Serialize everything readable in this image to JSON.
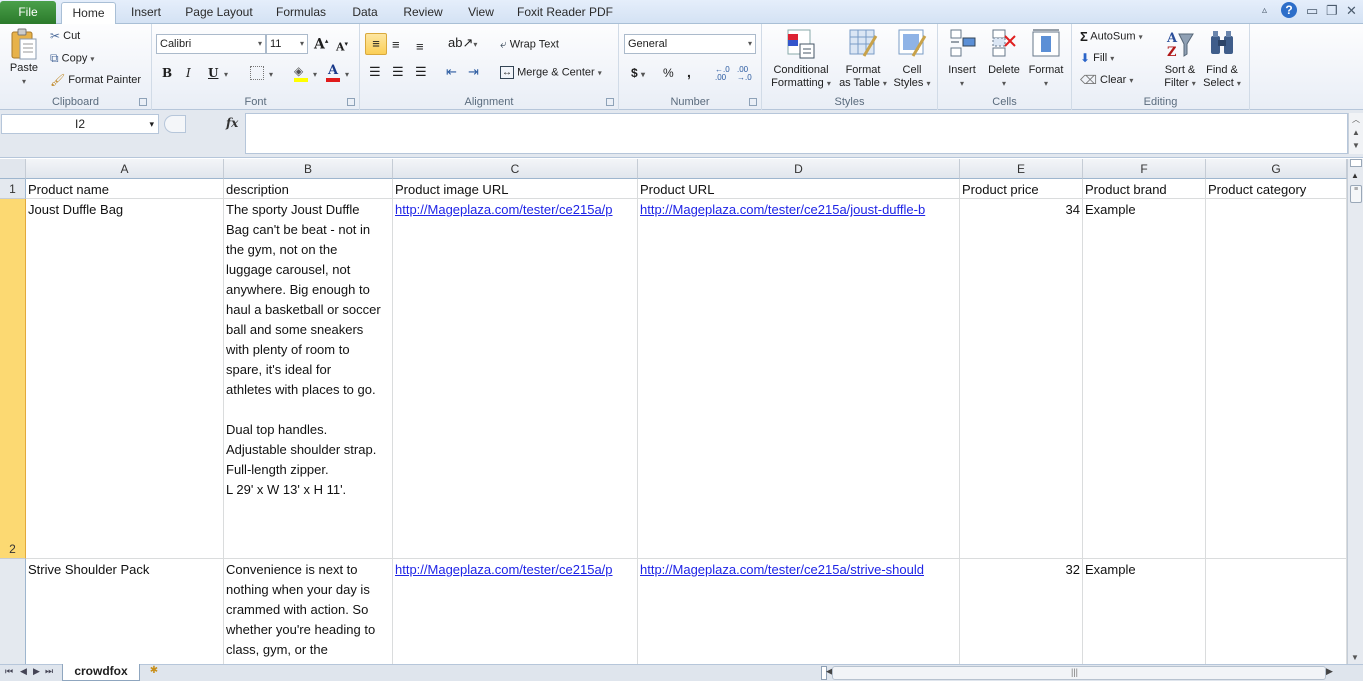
{
  "ribbon_tabs": [
    {
      "label": "File"
    },
    {
      "label": "Home",
      "active": true
    },
    {
      "label": "Insert"
    },
    {
      "label": "Page Layout"
    },
    {
      "label": "Formulas"
    },
    {
      "label": "Data"
    },
    {
      "label": "Review"
    },
    {
      "label": "View"
    },
    {
      "label": "Foxit Reader PDF"
    }
  ],
  "window_controls": {
    "minimize_ribbon": "▵",
    "help": "?",
    "minimize": "▭",
    "restore": "❐",
    "close": "✕"
  },
  "clipboard": {
    "group_label": "Clipboard",
    "paste": "Paste",
    "cut": "Cut",
    "copy": "Copy",
    "format_painter": "Format Painter"
  },
  "font": {
    "group_label": "Font",
    "font_name": "Calibri",
    "font_size": "11",
    "bold": "B",
    "italic": "I",
    "underline": "U",
    "grow": "A",
    "shrink": "A"
  },
  "alignment": {
    "group_label": "Alignment",
    "wrap_text": "Wrap Text",
    "merge_center": "Merge & Center"
  },
  "number": {
    "group_label": "Number",
    "format": "General",
    "currency": "$",
    "percent": "%",
    "comma": ",",
    "inc_decimal": "←.0 .00",
    "dec_decimal": ".00 →.0"
  },
  "styles": {
    "group_label": "Styles",
    "conditional_formatting": [
      "Conditional",
      "Formatting"
    ],
    "format_as_table": [
      "Format",
      "as Table"
    ],
    "cell_styles": [
      "Cell",
      "Styles"
    ]
  },
  "cells": {
    "group_label": "Cells",
    "insert": "Insert",
    "delete": "Delete",
    "format": "Format"
  },
  "editing": {
    "group_label": "Editing",
    "autosum": "AutoSum",
    "fill": "Fill",
    "clear": "Clear",
    "sort_filter": [
      "Sort &",
      "Filter"
    ],
    "find_select": [
      "Find &",
      "Select"
    ]
  },
  "formula_bar": {
    "name_box": "I2",
    "fx": "fx",
    "formula": ""
  },
  "grid": {
    "columns": [
      "A",
      "B",
      "C",
      "D",
      "E",
      "F",
      "G"
    ],
    "row_numbers": [
      "1",
      "2",
      ""
    ],
    "selected_row": "2",
    "header_row": [
      "Product name",
      "description",
      "Product image URL",
      "Product URL",
      "Product price",
      "Product brand",
      "Product category"
    ],
    "rows": [
      {
        "product_name": "Joust Duffle Bag",
        "description": "The sporty Joust Duffle\nBag can't be beat - not in\nthe gym, not on the\nluggage carousel, not\nanywhere. Big enough to\nhaul a basketball or soccer\nball and some sneakers\nwith plenty of room to\nspare, it's ideal for\nathletes with places to go.\n\nDual top handles.\nAdjustable shoulder strap.\nFull-length zipper.\nL 29' x W 13' x H 11'.",
        "image_url": "http://Mageplaza.com/tester/ce215a/p",
        "product_url": "http://Mageplaza.com/tester/ce215a/joust-duffle-b",
        "price": "34",
        "brand": "Example",
        "category": ""
      },
      {
        "product_name": "Strive Shoulder Pack",
        "description": "Convenience is next to\nnothing when your day is\ncrammed with action. So\nwhether you're heading to\nclass, gym, or the\nunbeaten path, make sure",
        "image_url": "http://Mageplaza.com/tester/ce215a/p",
        "product_url": "http://Mageplaza.com/tester/ce215a/strive-should",
        "price": "32",
        "brand": "Example",
        "category": ""
      }
    ]
  },
  "sheets": {
    "tabs": [
      "crowdfox"
    ],
    "nav": [
      "⏮",
      "◀",
      "▶",
      "⏭"
    ]
  }
}
